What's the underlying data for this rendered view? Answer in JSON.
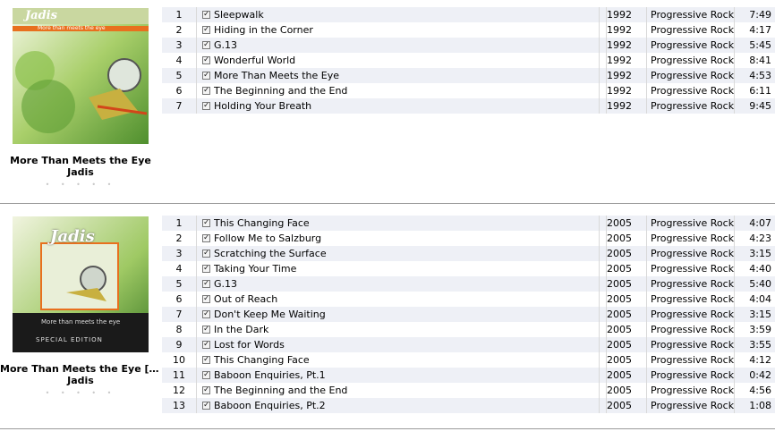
{
  "albums": [
    {
      "title": "More Than Meets the Eye",
      "artist": "Jadis",
      "rating": "• • • • •",
      "cover_text": {
        "band": "Jadis",
        "subtitle": "More than meets the eye"
      },
      "tracks": [
        {
          "num": "1",
          "name": "Sleepwalk",
          "year": "1992",
          "genre": "Progressive Rock",
          "time": "7:49"
        },
        {
          "num": "2",
          "name": "Hiding in the Corner",
          "year": "1992",
          "genre": "Progressive Rock",
          "time": "4:17"
        },
        {
          "num": "3",
          "name": "G.13",
          "year": "1992",
          "genre": "Progressive Rock",
          "time": "5:45"
        },
        {
          "num": "4",
          "name": "Wonderful World",
          "year": "1992",
          "genre": "Progressive Rock",
          "time": "8:41"
        },
        {
          "num": "5",
          "name": "More Than Meets the Eye",
          "year": "1992",
          "genre": "Progressive Rock",
          "time": "4:53"
        },
        {
          "num": "6",
          "name": "The Beginning and the End",
          "year": "1992",
          "genre": "Progressive Rock",
          "time": "6:11"
        },
        {
          "num": "7",
          "name": "Holding Your Breath",
          "year": "1992",
          "genre": "Progressive Rock",
          "time": "9:45"
        }
      ]
    },
    {
      "title": "More Than Meets the Eye [B...",
      "artist": "Jadis",
      "rating": "• • • • •",
      "cover_text": {
        "band": "Jadis",
        "subtitle": "More than meets the eye",
        "edition": "SPECIAL EDITION"
      },
      "tracks": [
        {
          "num": "1",
          "name": "This Changing Face",
          "year": "2005",
          "genre": "Progressive Rock",
          "time": "4:07"
        },
        {
          "num": "2",
          "name": "Follow Me to Salzburg",
          "year": "2005",
          "genre": "Progressive Rock",
          "time": "4:23"
        },
        {
          "num": "3",
          "name": "Scratching the Surface",
          "year": "2005",
          "genre": "Progressive Rock",
          "time": "3:15"
        },
        {
          "num": "4",
          "name": "Taking Your Time",
          "year": "2005",
          "genre": "Progressive Rock",
          "time": "4:40"
        },
        {
          "num": "5",
          "name": "G.13",
          "year": "2005",
          "genre": "Progressive Rock",
          "time": "5:40"
        },
        {
          "num": "6",
          "name": "Out of Reach",
          "year": "2005",
          "genre": "Progressive Rock",
          "time": "4:04"
        },
        {
          "num": "7",
          "name": "Don't Keep Me Waiting",
          "year": "2005",
          "genre": "Progressive Rock",
          "time": "3:15"
        },
        {
          "num": "8",
          "name": "In the Dark",
          "year": "2005",
          "genre": "Progressive Rock",
          "time": "3:59"
        },
        {
          "num": "9",
          "name": "Lost for Words",
          "year": "2005",
          "genre": "Progressive Rock",
          "time": "3:55"
        },
        {
          "num": "10",
          "name": "This Changing Face",
          "year": "2005",
          "genre": "Progressive Rock",
          "time": "4:12"
        },
        {
          "num": "11",
          "name": "Baboon Enquiries, Pt.1",
          "year": "2005",
          "genre": "Progressive Rock",
          "time": "0:42"
        },
        {
          "num": "12",
          "name": "The Beginning and the End",
          "year": "2005",
          "genre": "Progressive Rock",
          "time": "4:56"
        },
        {
          "num": "13",
          "name": "Baboon Enquiries, Pt.2",
          "year": "2005",
          "genre": "Progressive Rock",
          "time": "1:08"
        }
      ]
    }
  ],
  "colors": {
    "row_alt": "#eef0f6",
    "divider": "#9a9a9a",
    "cover_orange": "#e8701e",
    "cover_green": "#6fae3a"
  }
}
